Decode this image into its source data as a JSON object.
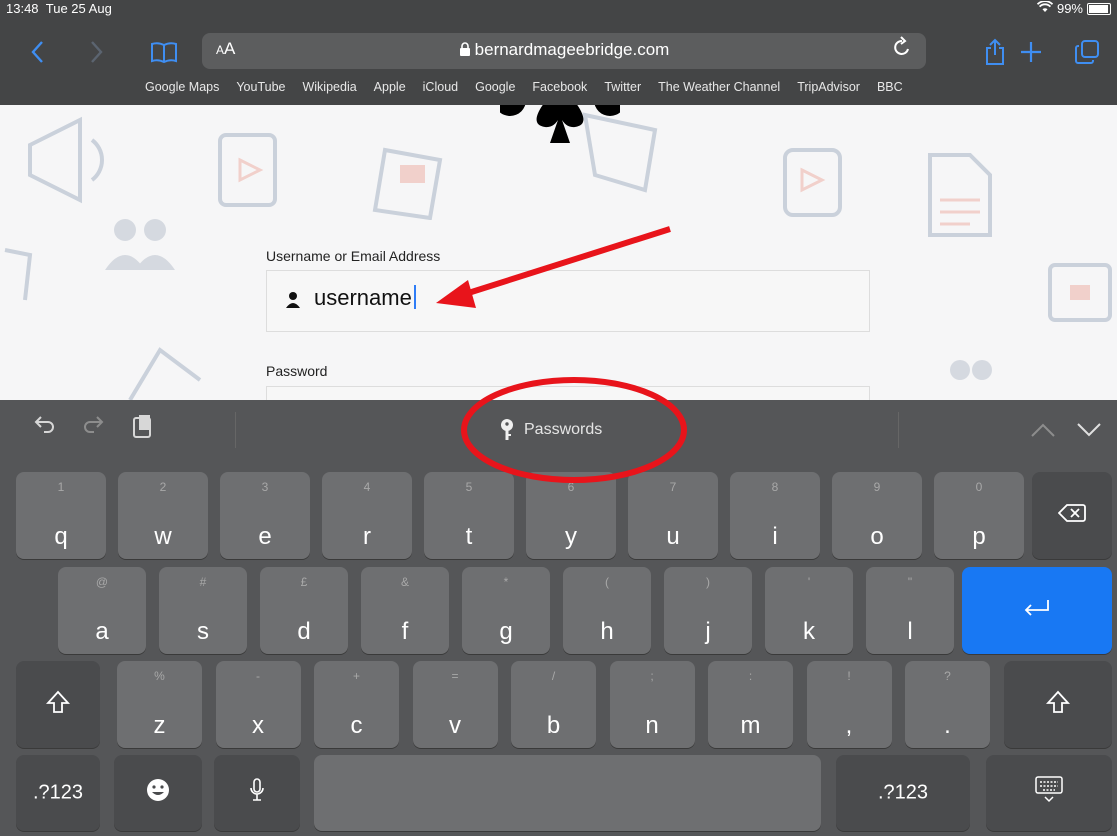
{
  "status": {
    "time": "13:48",
    "date": "Tue 25 Aug",
    "battery": "99%"
  },
  "browser": {
    "aa": "AA",
    "url": "bernardmageebridge.com",
    "bookmarks": [
      "Google Maps",
      "YouTube",
      "Wikipedia",
      "Apple",
      "iCloud",
      "Google",
      "Facebook",
      "Twitter",
      "The Weather Channel",
      "TripAdvisor",
      "BBC"
    ]
  },
  "form": {
    "username_label": "Username or Email Address",
    "username_value": "username",
    "password_label": "Password"
  },
  "keyboard": {
    "passwords_label": "Passwords",
    "row1": [
      {
        "main": "q",
        "sub": "1"
      },
      {
        "main": "w",
        "sub": "2"
      },
      {
        "main": "e",
        "sub": "3"
      },
      {
        "main": "r",
        "sub": "4"
      },
      {
        "main": "t",
        "sub": "5"
      },
      {
        "main": "y",
        "sub": "6"
      },
      {
        "main": "u",
        "sub": "7"
      },
      {
        "main": "i",
        "sub": "8"
      },
      {
        "main": "o",
        "sub": "9"
      },
      {
        "main": "p",
        "sub": "0"
      }
    ],
    "row2": [
      {
        "main": "a",
        "sub": "@"
      },
      {
        "main": "s",
        "sub": "#"
      },
      {
        "main": "d",
        "sub": "£"
      },
      {
        "main": "f",
        "sub": "&"
      },
      {
        "main": "g",
        "sub": "*"
      },
      {
        "main": "h",
        "sub": "("
      },
      {
        "main": "j",
        "sub": ")"
      },
      {
        "main": "k",
        "sub": "'"
      },
      {
        "main": "l",
        "sub": "\""
      }
    ],
    "row3": [
      {
        "main": "z",
        "sub": "%"
      },
      {
        "main": "x",
        "sub": "-"
      },
      {
        "main": "c",
        "sub": "+"
      },
      {
        "main": "v",
        "sub": "="
      },
      {
        "main": "b",
        "sub": "/"
      },
      {
        "main": "n",
        "sub": ";"
      },
      {
        "main": "m",
        "sub": ":"
      },
      {
        "main": ",",
        "sub": "!"
      },
      {
        "main": ".",
        "sub": "?"
      }
    ],
    "numbers_label": ".?123"
  },
  "colors": {
    "accent": "#3f8ef2",
    "return_key": "#1878f3",
    "annotation": "#e8141b"
  }
}
